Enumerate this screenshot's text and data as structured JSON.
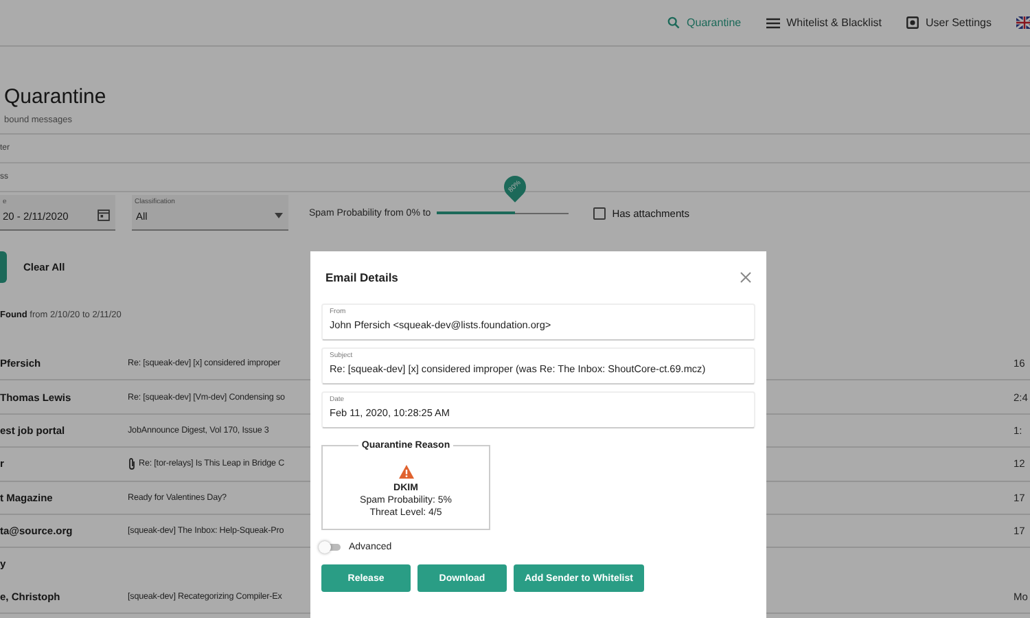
{
  "nav": {
    "items": [
      {
        "label": "Quarantine",
        "selected": true
      },
      {
        "label": "Whitelist & Blacklist",
        "selected": false
      },
      {
        "label": "User Settings",
        "selected": false
      }
    ]
  },
  "header": {
    "title": "Quarantine",
    "subtitle": "bound messages"
  },
  "cut_labels": [
    "ter",
    "ss"
  ],
  "filters": {
    "date": {
      "label": "e",
      "value": "20 - 2/11/2020"
    },
    "classification": {
      "label": "Classification",
      "value": "All"
    },
    "spam": {
      "label": "Spam Probability from 0% to",
      "level": 0.6,
      "reading": "80%"
    },
    "attachments": {
      "label": "Has attachments",
      "checked": false
    }
  },
  "clear_all": "Clear All",
  "results_summary": "**Found** from 2/10/20 to 2/11/20",
  "messages": [
    {
      "kind": "message",
      "sender": "Pfersich",
      "subject": "Re: [squeak-dev] [x] considered improper",
      "time": "16",
      "attachment": false
    },
    {
      "kind": "message",
      "sender": "Thomas Lewis",
      "subject": "Re: [squeak-dev] [Vm-dev] Condensing so",
      "time": "2:4",
      "attachment": false
    },
    {
      "kind": "message",
      "sender": "est job portal",
      "subject": "JobAnnounce Digest, Vol 170, Issue 3",
      "time": "1:",
      "attachment": false
    },
    {
      "kind": "message",
      "sender": "r",
      "subject": "Re: [tor-relays] Is This Leap in Bridge C",
      "time": "12",
      "attachment": true
    },
    {
      "kind": "message",
      "sender": "t Magazine",
      "subject": "Ready for Valentines Day?",
      "time": "17",
      "attachment": false
    },
    {
      "kind": "message",
      "sender": "ta@source.org",
      "subject": "[squeak-dev] The Inbox: Help-Squeak-Pro",
      "time": "17",
      "attachment": false
    },
    {
      "kind": "group",
      "label": "y"
    },
    {
      "kind": "message",
      "sender": "e, Christoph",
      "subject": "[squeak-dev] Recategorizing Compiler-Ex",
      "time": "Mo",
      "attachment": false
    }
  ],
  "modal": {
    "title": "Email Details",
    "fields": [
      {
        "label": "From",
        "value": "John Pfersich <squeak-dev@lists.foundation.org>"
      },
      {
        "label": "Subject",
        "value": "Re: [squeak-dev] [x] considered improper (was Re: The Inbox:  ShoutCore-ct.69.mcz)"
      },
      {
        "label": "Date",
        "value": "Feb 11, 2020, 10:28:25 AM"
      }
    ],
    "reason": {
      "title": "Quarantine Reason",
      "type": "DKIM",
      "lines": [
        "Spam Probability: 5%",
        "Threat Level: 4/5"
      ]
    },
    "advanced": {
      "label": "Advanced",
      "on": false
    },
    "buttons": [
      "Release",
      "Download",
      "Add Sender to Whitelist"
    ]
  }
}
